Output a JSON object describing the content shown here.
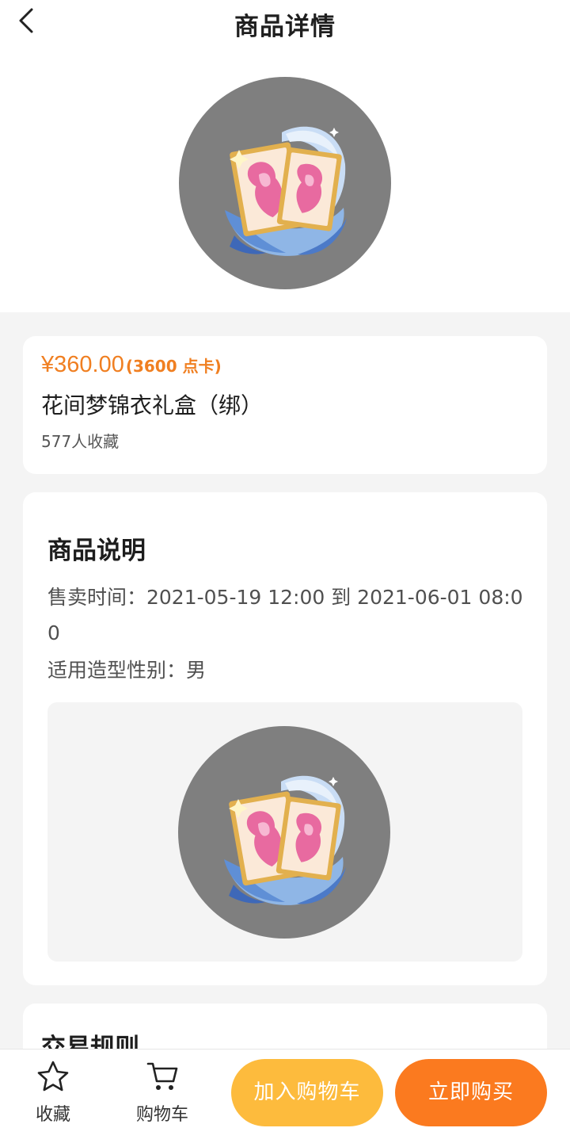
{
  "header": {
    "title": "商品详情",
    "back_icon": "chevron-left-icon"
  },
  "product": {
    "price": "¥360.00",
    "price_points": "(3600 点卡)",
    "name": "花间梦锦衣礼盒（绑）",
    "favorite_count": "577人收藏",
    "image": "gift-box-outfit-cards"
  },
  "description": {
    "title": "商品说明",
    "sale_time": "售卖时间：2021-05-19 12:00 到 2021-06-01 08:00",
    "gender": "适用造型性别：男"
  },
  "rules": {
    "title": "交易规则"
  },
  "bottom_bar": {
    "favorite_label": "收藏",
    "favorite_icon": "star-outline-icon",
    "cart_label": "购物车",
    "cart_icon": "shopping-cart-icon",
    "add_to_cart_label": "加入购物车",
    "buy_now_label": "立即购买"
  },
  "colors": {
    "accent_orange": "#f07f21",
    "add_cart_button": "#fdbb3d",
    "buy_button": "#fb7a1f",
    "image_backdrop": "#7f7f7f"
  }
}
